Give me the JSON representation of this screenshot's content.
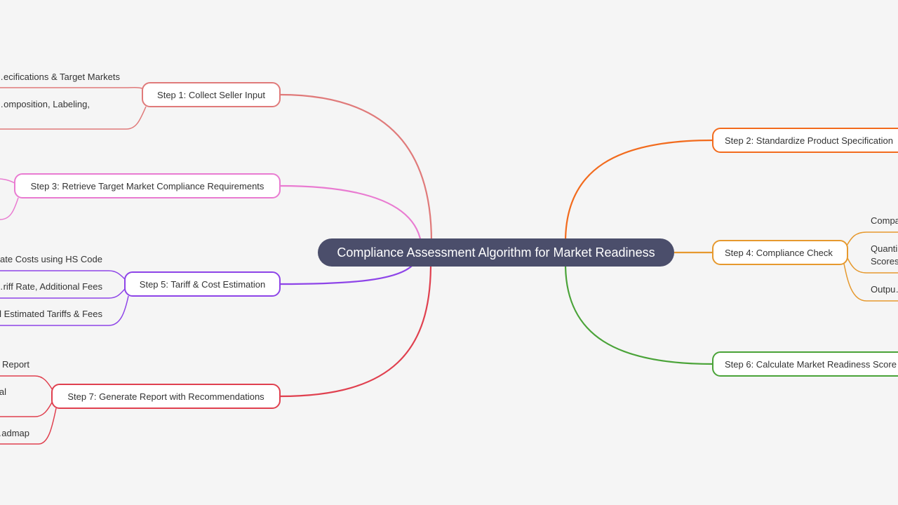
{
  "root": {
    "label": "Compliance Assessment Algorithm for Market Readiness",
    "color": "#4b4e6b"
  },
  "steps": [
    {
      "id": "step1",
      "label": "Step 1: Collect Seller Input",
      "color": "#e07a7a",
      "leaves": [
        "…ecifications & Target Markets",
        "…omposition, Labeling,"
      ]
    },
    {
      "id": "step2",
      "label": "Step 2: Standardize Product Specification",
      "color": "#f26b1d",
      "leaves": []
    },
    {
      "id": "step3",
      "label": "Step 3: Retrieve Target Market Compliance Requirements",
      "color": "#e97bd1",
      "leaves": []
    },
    {
      "id": "step4",
      "label": "Step 4: Compliance Check",
      "color": "#e6992e",
      "leaves": [
        "Compa…",
        "Quanti…",
        "Scores…",
        "Outpu…"
      ]
    },
    {
      "id": "step5",
      "label": "Step 5: Tariff & Cost Estimation",
      "color": "#8e44e8",
      "leaves": [
        "…nate Costs using HS Code",
        "…riff Rate, Additional Fees",
        "…l Estimated Tariffs & Fees"
      ]
    },
    {
      "id": "step6",
      "label": "Step 6: Calculate Market Readiness Score",
      "color": "#4aa338",
      "leaves": []
    },
    {
      "id": "step7",
      "label": "Step 7: Generate Report with Recommendations",
      "color": "#e0404f",
      "leaves": [
        "… Report",
        "…al",
        "…admap"
      ]
    }
  ]
}
